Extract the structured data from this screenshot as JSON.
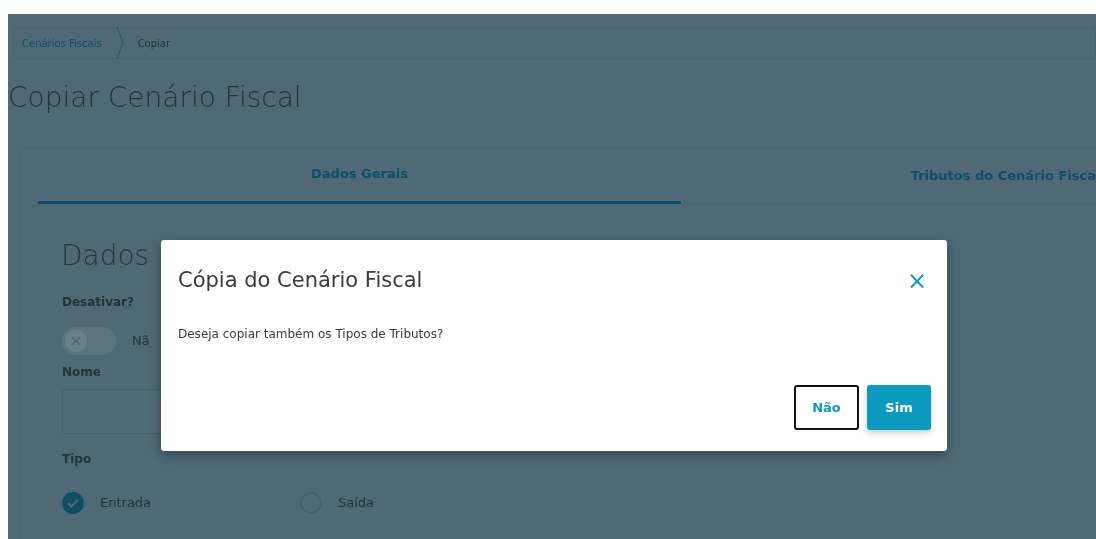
{
  "breadcrumb": [
    {
      "label": "Cenários Fiscais",
      "kind": "link"
    },
    {
      "label": "Copiar",
      "kind": "current"
    }
  ],
  "page_title": "Copiar Cenário Fiscal",
  "tabs": [
    {
      "label": "Dados Gerais",
      "selected": true
    },
    {
      "label": "Tributos do Cenário Fisca",
      "selected": false
    }
  ],
  "form": {
    "section_title": "Dados",
    "deactivate": {
      "label": "Desativar?",
      "on": false,
      "state_label": "Nã"
    },
    "name": {
      "label": "Nome"
    },
    "type": {
      "label": "Tipo",
      "options": [
        {
          "label": "Entrada",
          "selected": true
        },
        {
          "label": "Saída",
          "selected": false
        }
      ]
    }
  },
  "dialog": {
    "title": "Cópia do Cenário Fiscal",
    "close": "×",
    "message": "Deseja copiar também os Tipos de Tributos?",
    "buttons": [
      {
        "label": "Não",
        "kind": "secondary"
      },
      {
        "label": "Sim",
        "kind": "primary"
      }
    ]
  }
}
